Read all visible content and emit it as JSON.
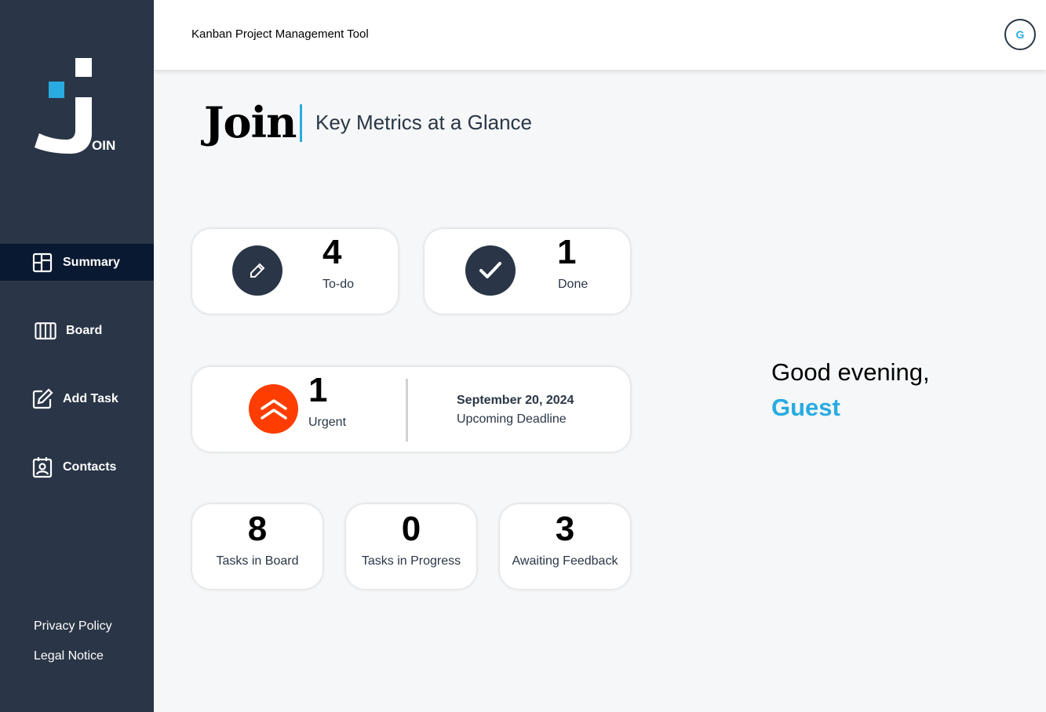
{
  "app": {
    "header_title": "Kanban Project Management Tool",
    "avatar_initial": "G",
    "logo_text": "OIN"
  },
  "sidebar": {
    "items": [
      {
        "label": "Summary",
        "icon": "summary-icon",
        "active": true
      },
      {
        "label": "Board",
        "icon": "board-icon",
        "active": false
      },
      {
        "label": "Add Task",
        "icon": "add-task-icon",
        "active": false
      },
      {
        "label": "Contacts",
        "icon": "contacts-icon",
        "active": false
      }
    ],
    "footer": [
      "Privacy Policy",
      "Legal Notice"
    ]
  },
  "main": {
    "title": "Join",
    "subtitle": "Key Metrics at a Glance",
    "todo": {
      "count": "4",
      "label": "To-do",
      "icon": "pencil-icon"
    },
    "done": {
      "count": "1",
      "label": "Done",
      "icon": "checkmark-icon"
    },
    "urgent": {
      "count": "1",
      "label": "Urgent",
      "icon": "double-chevron-up-icon"
    },
    "deadline": {
      "date": "September 20, 2024",
      "label": "Upcoming Deadline"
    },
    "tasks_in_board": {
      "count": "8",
      "label": "Tasks in Board"
    },
    "tasks_in_progress": {
      "count": "0",
      "label": "Tasks in Progress"
    },
    "awaiting_feedback": {
      "count": "3",
      "label": "Awaiting Feedback"
    },
    "greeting": "Good evening,",
    "user_name": "Guest"
  },
  "colors": {
    "sidebar_bg": "#2a3647",
    "active_nav_bg": "#091931",
    "accent": "#29abe2",
    "urgent": "#ff3d00",
    "background": "#f6f7f8"
  }
}
